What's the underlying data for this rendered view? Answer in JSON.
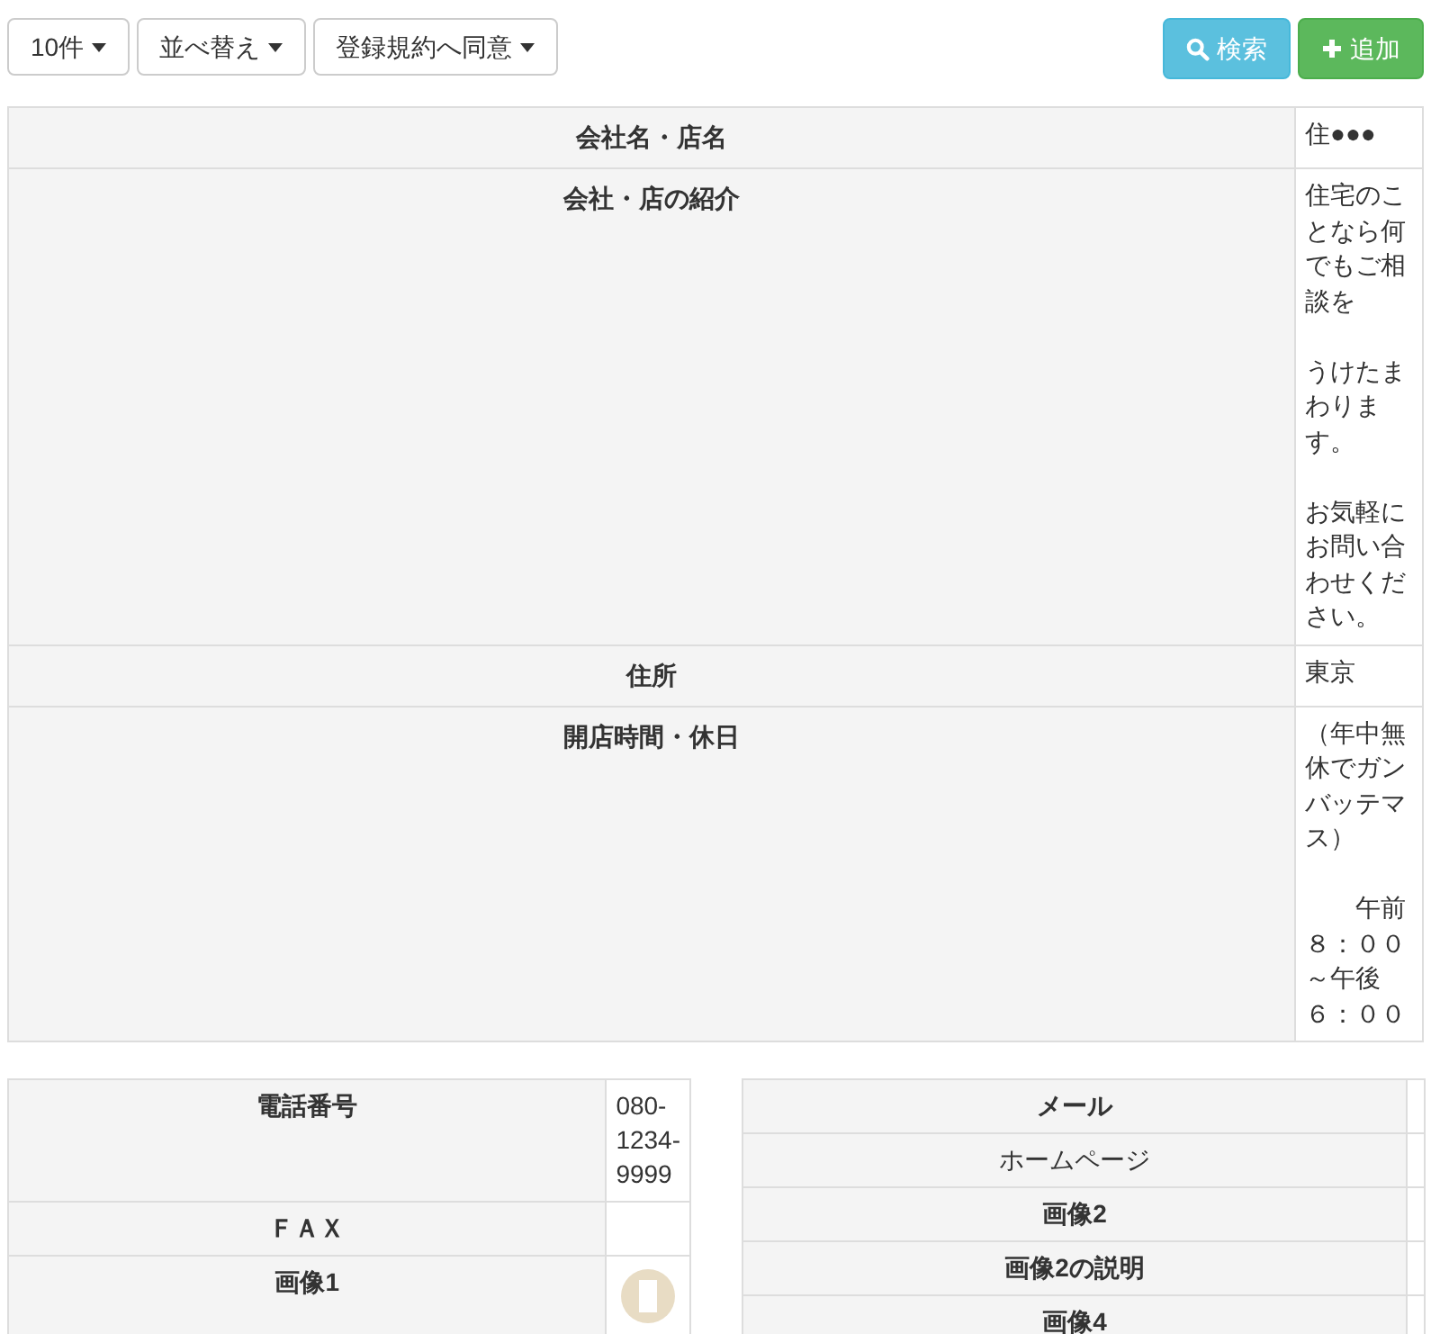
{
  "toolbar": {
    "dropdowns": [
      {
        "label": "10件"
      },
      {
        "label": "並べ替え"
      },
      {
        "label": "登録規約へ同意"
      }
    ],
    "buttons": [
      {
        "label": "検索",
        "kind": "search"
      },
      {
        "label": "追加",
        "kind": "add"
      }
    ]
  },
  "main_table": {
    "rows": [
      {
        "label": "会社名・店名",
        "value": [
          "住●●●"
        ]
      },
      {
        "label": "会社・店の紹介",
        "value": [
          "住宅のことなら何でもご相談を",
          "うけたまわります。",
          "お気軽にお問い合わせください。"
        ]
      },
      {
        "label": "住所",
        "value": [
          "東京"
        ]
      },
      {
        "label": "開店時間・休日",
        "value": [
          "（年中無休でガンバッテマス）",
          "　　午前８：００～午後６：００"
        ]
      }
    ]
  },
  "left_table": {
    "rows": [
      {
        "label": "電話番号",
        "value": "080-1234-9999",
        "kind": "text"
      },
      {
        "label": "ＦＡＸ",
        "value": "",
        "kind": "text"
      },
      {
        "label": "画像1",
        "kind": "image"
      }
    ]
  },
  "right_table": {
    "rows": [
      {
        "label": "メール",
        "bold": true
      },
      {
        "label": "ホームページ",
        "bold": false
      },
      {
        "label": "画像2",
        "bold": true
      },
      {
        "label": "画像2の説明",
        "bold": true
      },
      {
        "label": "画像4",
        "bold": true
      }
    ]
  }
}
